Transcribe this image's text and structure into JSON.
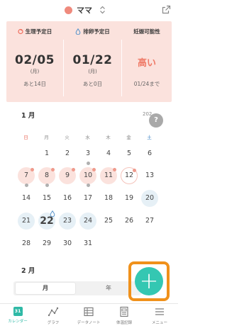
{
  "header": {
    "profile_name": "ママ"
  },
  "panel": {
    "period": {
      "title": "生理予定日",
      "date": "02/05",
      "weekday": "(月)",
      "foot": "あと14日"
    },
    "ovulation": {
      "title": "排卵予定日",
      "date": "01/22",
      "weekday": "(月)",
      "foot": "あと0日"
    },
    "fertility": {
      "title": "妊娠可能性",
      "level": "高い",
      "foot": "01/24まで"
    }
  },
  "calendar": {
    "month_jan": "1 月",
    "year_hint": "202",
    "help": "?",
    "weekdays": [
      "日",
      "月",
      "火",
      "水",
      "木",
      "金",
      "土"
    ],
    "weekday_colors": {
      "sun": "#e9695a",
      "sat": "#3d83c6",
      "normal": "#888888"
    },
    "days": [
      "1",
      "2",
      "3",
      "4",
      "5",
      "6",
      "7",
      "8",
      "9",
      "10",
      "11",
      "12",
      "13",
      "14",
      "15",
      "16",
      "17",
      "18",
      "19",
      "20",
      "21",
      "22",
      "23",
      "24",
      "25",
      "26",
      "27",
      "28",
      "29",
      "30",
      "31"
    ],
    "month_feb": "2 月"
  },
  "segment": {
    "month": "月",
    "year": "年"
  },
  "fab": {
    "label": "+"
  },
  "nav": {
    "calendar_num": "31",
    "calendar": "カレンダー",
    "graph": "グラフ",
    "data": "データノート",
    "record": "体温記録",
    "menu": "メニュー"
  },
  "colors": {
    "accent": "#2fb9a6",
    "period_bg": "#fbe2dd",
    "ovulation_bg": "#e6f0f6",
    "highlight": "#f0911b"
  }
}
